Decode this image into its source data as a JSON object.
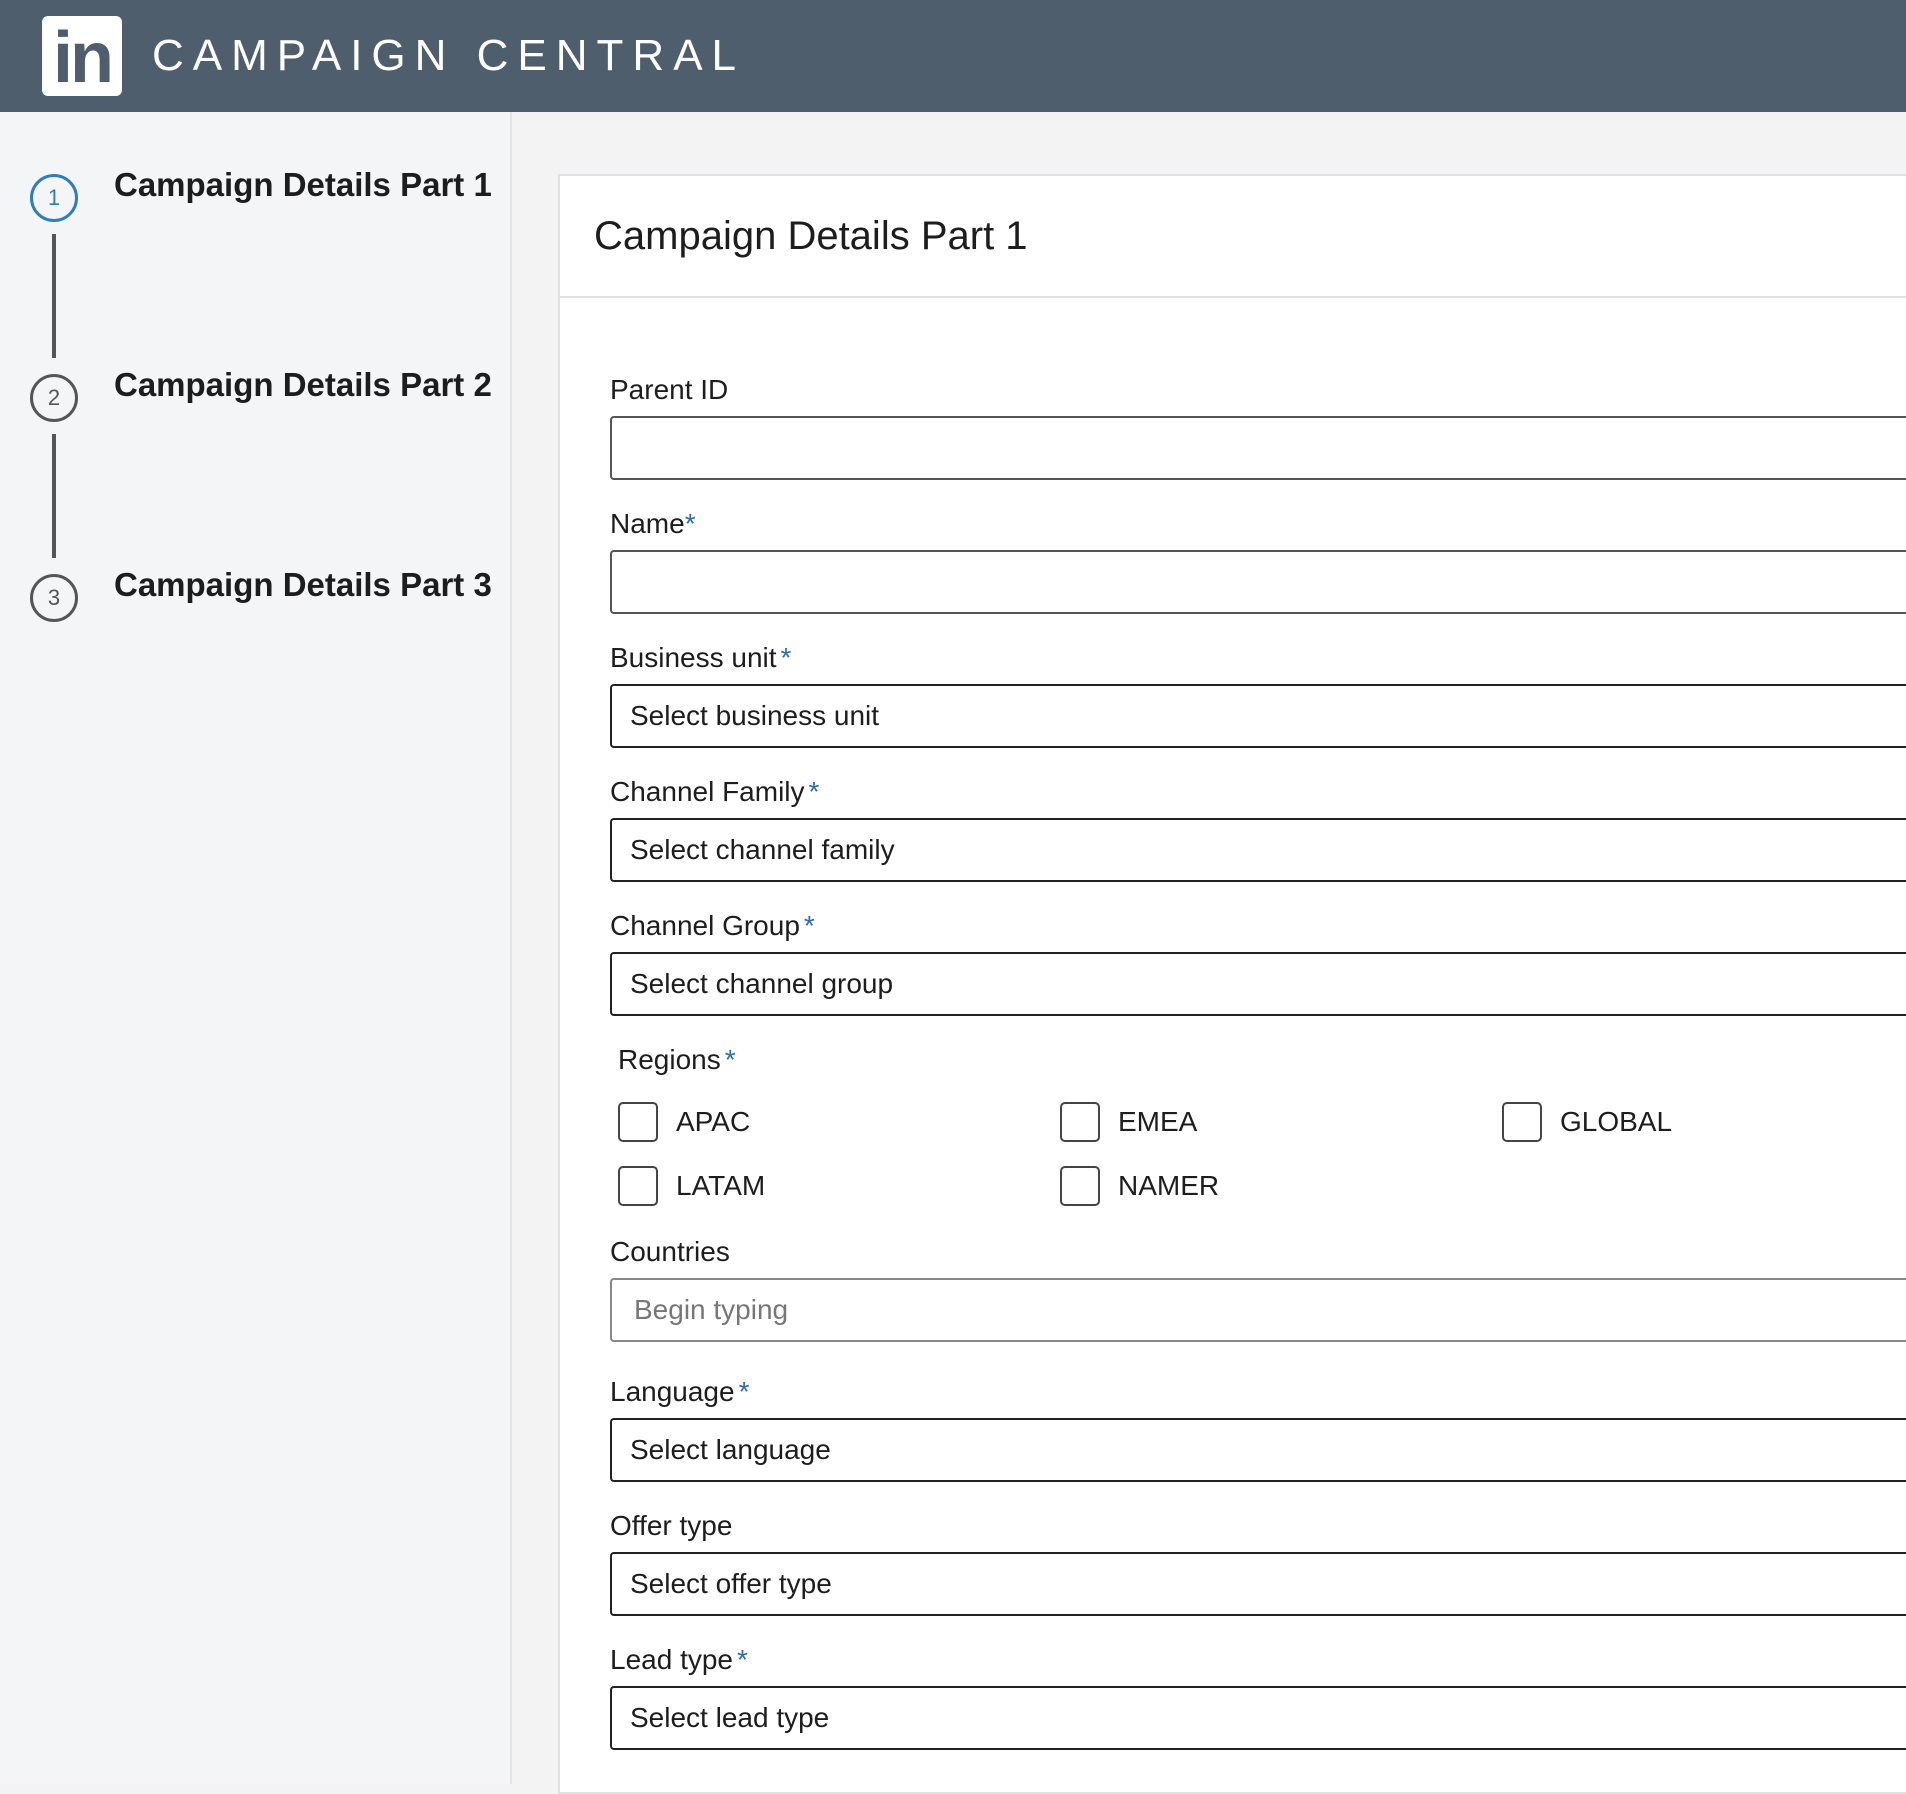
{
  "header": {
    "logo_text": "in",
    "title": "CAMPAIGN CENTRAL"
  },
  "steps": [
    {
      "number": "1",
      "label": "Campaign Details Part 1",
      "active": true
    },
    {
      "number": "2",
      "label": "Campaign Details Part 2",
      "active": false
    },
    {
      "number": "3",
      "label": "Campaign Details Part 3",
      "active": false
    }
  ],
  "form": {
    "title": "Campaign Details Part 1",
    "required_marker": "*",
    "parent_id": {
      "label": "Parent ID",
      "value": ""
    },
    "name": {
      "label": "Name",
      "value": ""
    },
    "business_unit": {
      "label": "Business unit",
      "value": "Select business unit"
    },
    "channel_family": {
      "label": "Channel Family",
      "value": "Select channel family"
    },
    "channel_group": {
      "label": "Channel Group",
      "value": "Select channel group"
    },
    "regions": {
      "label": "Regions",
      "options": [
        {
          "label": "APAC",
          "checked": false
        },
        {
          "label": "EMEA",
          "checked": false
        },
        {
          "label": "GLOBAL",
          "checked": false
        },
        {
          "label": "LATAM",
          "checked": false
        },
        {
          "label": "NAMER",
          "checked": false
        }
      ]
    },
    "countries": {
      "label": "Countries",
      "placeholder": "Begin typing"
    },
    "language": {
      "label": "Language",
      "value": "Select language"
    },
    "offer_type": {
      "label": "Offer type",
      "value": "Select offer type"
    },
    "lead_type": {
      "label": "Lead type",
      "value": "Select lead type"
    }
  },
  "colors": {
    "header_bg": "#4e5e6c",
    "active_step": "#2f7dbb",
    "required_marker": "#2a6bb0"
  }
}
